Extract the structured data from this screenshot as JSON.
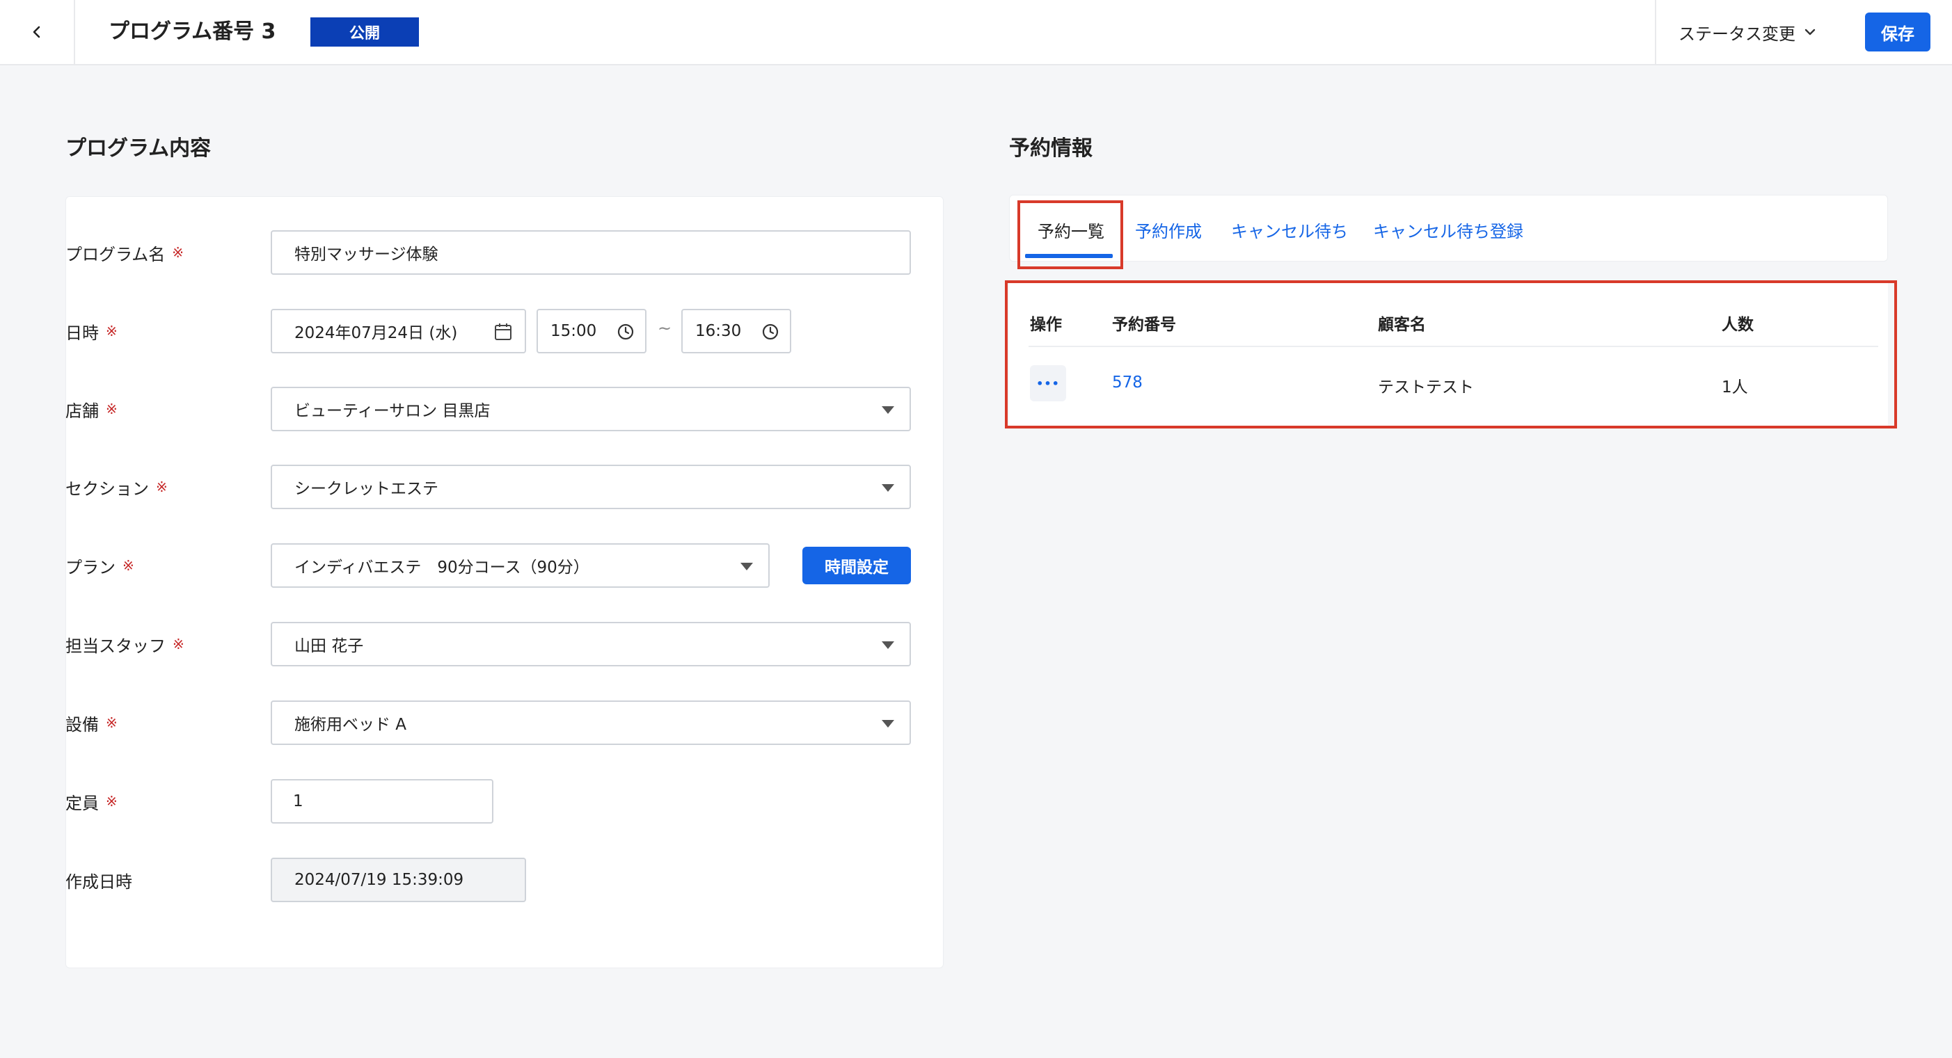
{
  "header": {
    "title": "プログラム番号 3",
    "status_badge": "公開",
    "status_change_label": "ステータス変更",
    "save_label": "保存"
  },
  "program": {
    "section_title": "プログラム内容",
    "required_mark": "※",
    "fields": {
      "name": {
        "label": "プログラム名",
        "value": "特別マッサージ体験"
      },
      "datetime": {
        "label": "日時",
        "date": "2024年07月24日 (水)",
        "start": "15:00",
        "end": "16:30",
        "separator": "~"
      },
      "store": {
        "label": "店舗",
        "value": "ビューティーサロン 目黒店"
      },
      "section": {
        "label": "セクション",
        "value": "シークレットエステ"
      },
      "plan": {
        "label": "プラン",
        "value": "インディバエステ　90分コース（90分）",
        "button": "時間設定"
      },
      "staff": {
        "label": "担当スタッフ",
        "value": "山田 花子"
      },
      "equipment": {
        "label": "設備",
        "value": "施術用ベッド A"
      },
      "capacity": {
        "label": "定員",
        "value": "1"
      },
      "created": {
        "label": "作成日時",
        "value": "2024/07/19 15:39:09"
      }
    }
  },
  "reservation": {
    "section_title": "予約情報",
    "tabs": [
      {
        "label": "予約一覧",
        "active": true
      },
      {
        "label": "予約作成",
        "active": false
      },
      {
        "label": "キャンセル待ち",
        "active": false
      },
      {
        "label": "キャンセル待ち登録",
        "active": false
      }
    ],
    "table": {
      "headers": [
        "操作",
        "予約番号",
        "顧客名",
        "人数"
      ],
      "rows": [
        {
          "action": "•••",
          "number": "578",
          "customer": "テストテスト",
          "count": "1人"
        }
      ]
    }
  },
  "colors": {
    "primary": "#1565e6",
    "badge": "#0b3fb5",
    "highlight": "#d83a2a",
    "required": "#c62828"
  }
}
